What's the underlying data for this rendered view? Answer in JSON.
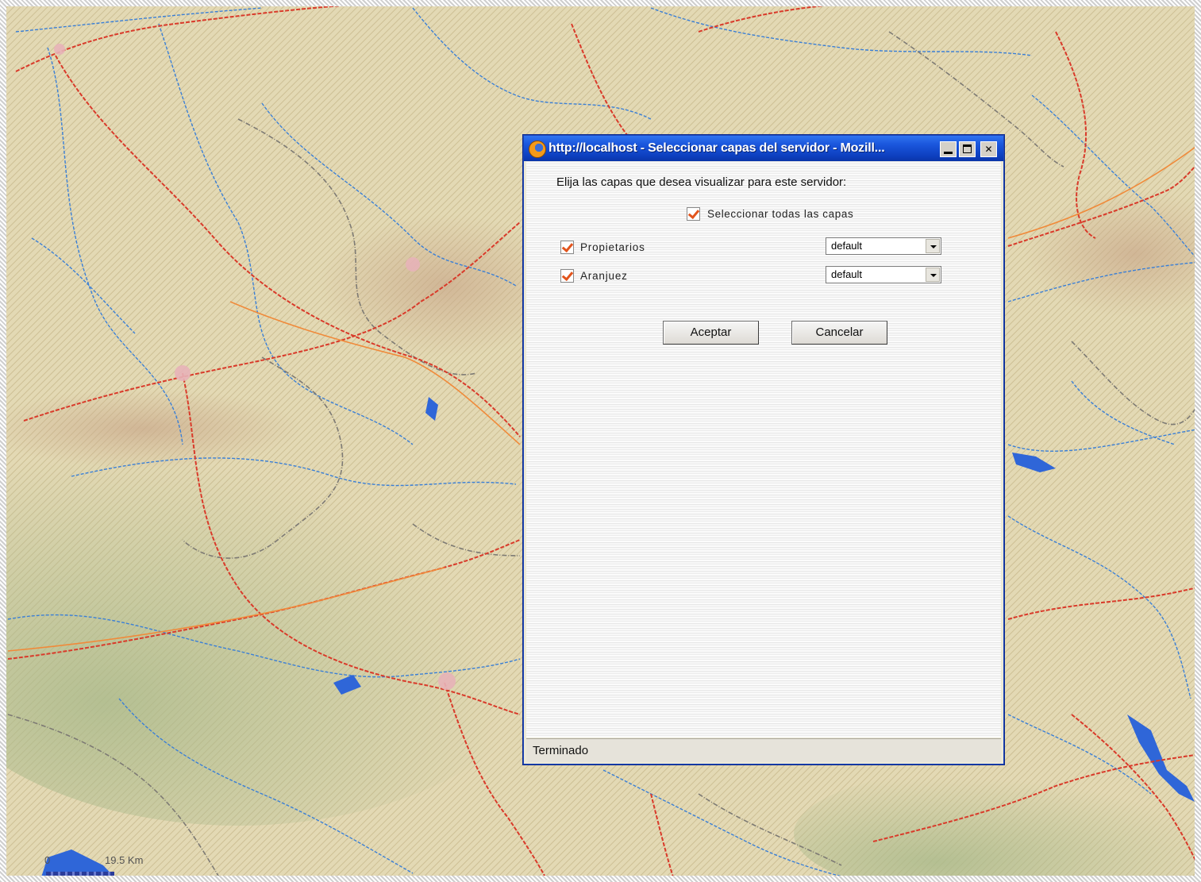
{
  "map": {
    "scale_labels": [
      "0",
      "19.5 Km"
    ]
  },
  "popup": {
    "title": "http://localhost - Seleccionar capas del servidor - Mozill...",
    "prompt": "Elija las capas que desea visualizar para este servidor:",
    "select_all": {
      "label": "Seleccionar todas las capas",
      "checked": true
    },
    "layers": [
      {
        "name": "Propietarios",
        "checked": true,
        "style": "default"
      },
      {
        "name": "Aranjuez",
        "checked": true,
        "style": "default"
      }
    ],
    "buttons": {
      "ok": "Aceptar",
      "cancel": "Cancelar"
    },
    "status": "Terminado"
  },
  "colors": {
    "titlebar": "#0d3fbf",
    "checkmark": "#e2541d",
    "roads": "#d93a2a",
    "rivers": "#3a7fd6",
    "borders": "#7d7a74"
  }
}
